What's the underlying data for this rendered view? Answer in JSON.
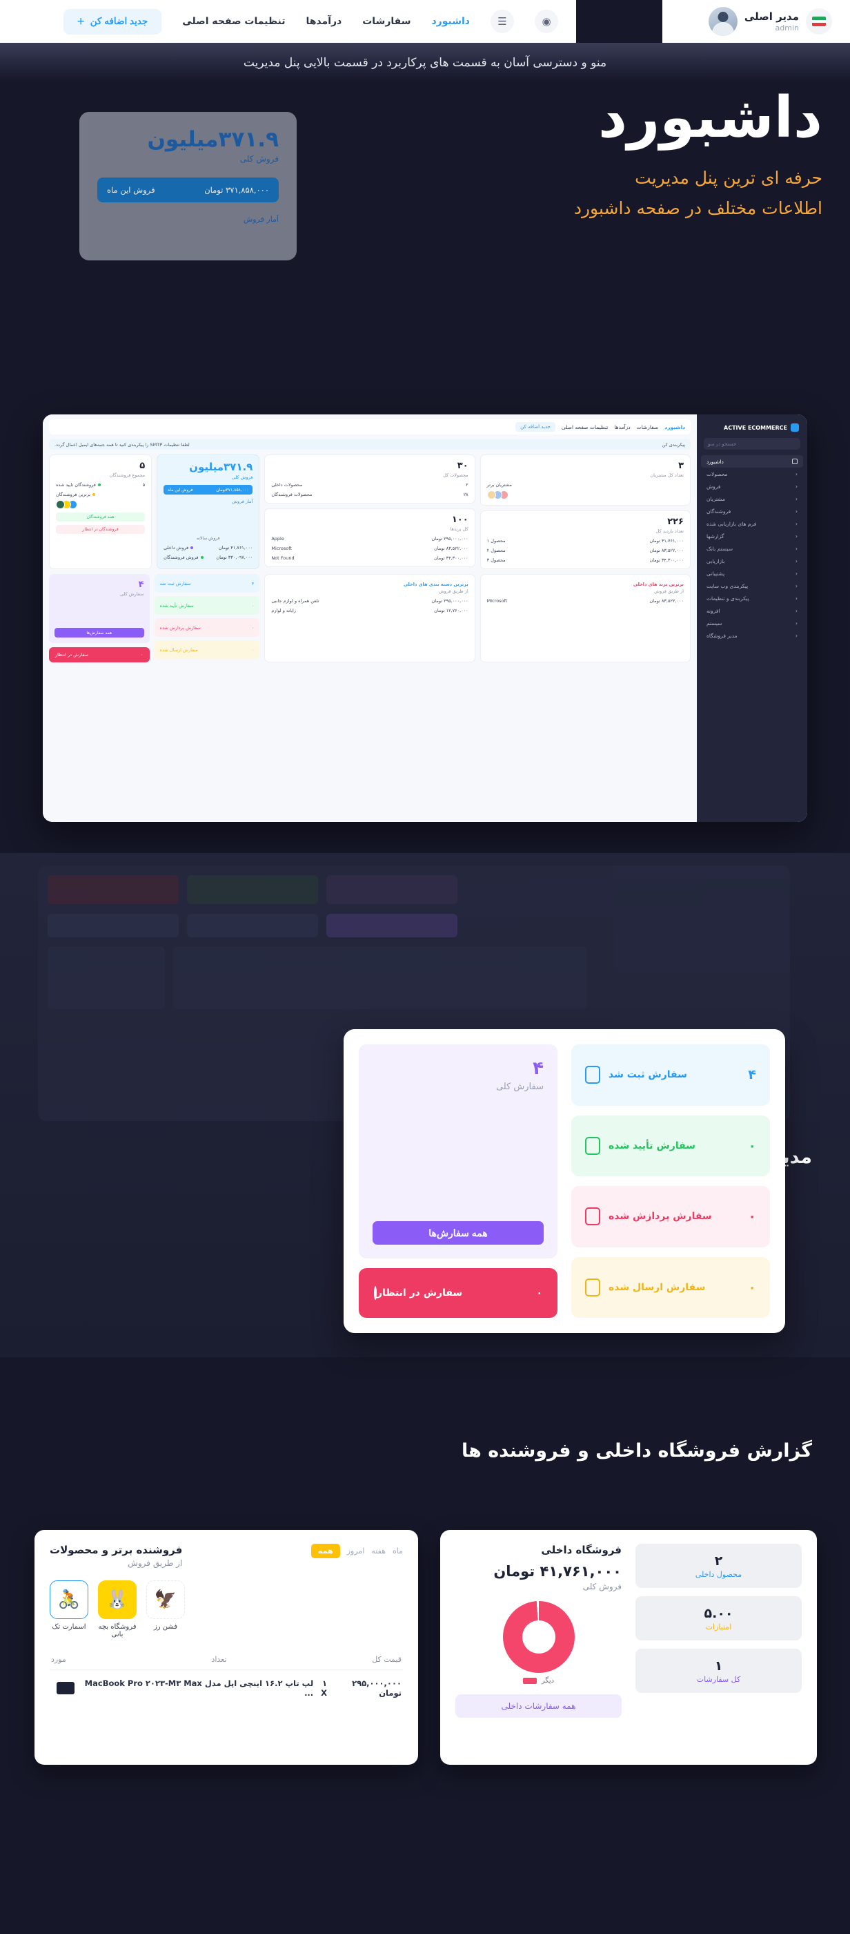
{
  "topbar": {
    "user_name": "مدیر اصلی",
    "user_role": "admin",
    "flag_name": "iran-flag",
    "add_button": "جدید اضافه کن",
    "nav": [
      {
        "label": "تنظیمات صفحه اصلی",
        "active": false
      },
      {
        "label": "درآمدها",
        "active": false
      },
      {
        "label": "سفارشات",
        "active": false
      },
      {
        "label": "داشبورد",
        "active": true
      }
    ],
    "icons": [
      "globe-icon",
      "chart-icon"
    ]
  },
  "banner": {
    "text": "منو و دسترسی آسان به قسمت های پرکاربرد در قسمت بالایی پنل مدیریت"
  },
  "hero": {
    "title": "داشبورد",
    "subtitle_1": "حرفه ای ترین پنل مدیریت",
    "subtitle_2": "اطلاعات مختلف در صفحه داشبورد",
    "card": {
      "amount": "۳۷۱.۹میلیون",
      "label": "فروش کلی",
      "bar_label": "فروش این ماه",
      "bar_value": "۳۷۱,۸۵۸,۰۰۰ تومان",
      "footer": "آمار فروش"
    },
    "accent_color": "#f7a738"
  },
  "shot": {
    "sidebar": {
      "logo": "ACTIVE ECOMMERCE",
      "search_placeholder": "جستجو در منو",
      "items": [
        {
          "label": "داشبورد",
          "active": true
        },
        {
          "label": "محصولات",
          "active": false
        },
        {
          "label": "فروش",
          "active": false
        },
        {
          "label": "مشتریان",
          "active": false
        },
        {
          "label": "فروشندگان",
          "active": false
        },
        {
          "label": "فرم های بازاریابی شده",
          "active": false
        },
        {
          "label": "گزارشها",
          "active": false
        },
        {
          "label": "سیستم بانک",
          "active": false
        },
        {
          "label": "بازاریابی",
          "active": false
        },
        {
          "label": "پشتیبانی",
          "active": false
        },
        {
          "label": "پیکربندی وب سایت",
          "active": false
        },
        {
          "label": "پیکربندی و تنظیمات",
          "active": false
        },
        {
          "label": "افزونه",
          "active": false
        },
        {
          "label": "سیستم",
          "active": false
        },
        {
          "label": "مدیر فروشگاه",
          "active": false
        }
      ]
    },
    "topnav": [
      {
        "label": "تنظیمات صفحه اصلی",
        "active": false
      },
      {
        "label": "درآمدها",
        "active": false
      },
      {
        "label": "سفارشات",
        "active": false
      },
      {
        "label": "داشبورد",
        "active": true
      }
    ],
    "add_button": "جدید اضافه کن",
    "notice": "لطفا تنظیمات SMTP را پیکربندی کنید تا همه جنبه‌های ایمیل اعمال گردد.",
    "notice_action": "پیکربندی کن",
    "cards": {
      "vendors": {
        "number": "۵",
        "label": "مجموع فروشندگان",
        "rows": [
          {
            "label": "فروشندگان تایید شده",
            "value": "۵",
            "color": "#22c55e"
          },
          {
            "label": "برترین فروشندگان",
            "value": "",
            "color": "#ffc107"
          }
        ],
        "btn_all": "همه فروشندگان",
        "btn_pending": "فروشندگان در انتظار"
      },
      "sales": {
        "amount": "۳۷۱.۹میلیون",
        "label": "فروش کلی",
        "bar_label": "فروش این ماه",
        "bar_value": "۳۷۱,۸۵۸,۰۰۰تومان",
        "sub": "آمار فروش",
        "chart_label": "فروش سالانه",
        "legend": [
          {
            "name": "فروش داخلی",
            "value": "۴۱,۷۶۱,۰۰۰ تومان",
            "color": "#8b5cf6"
          },
          {
            "name": "فروش فروشندگان",
            "value": "۳۳۰,۰۹۷,۰۰۰ تومان",
            "color": "#22c55e"
          }
        ]
      },
      "products": {
        "number": "۳۰",
        "label": "محصولات کل",
        "rows": [
          {
            "label": "محصولات داخلی",
            "value": "۲"
          },
          {
            "label": "محصولات فروشندگان",
            "value": "۲۸"
          }
        ]
      },
      "customers": {
        "number": "۳",
        "label": "تعداد کل مشتریان",
        "row_label": "مشتریان برتر"
      },
      "orders_count": {
        "number": "۱۰۰",
        "label": "کل برندها",
        "rows": [
          {
            "label": "Apple",
            "value": "۲۹۵,۰۰۰,۰۰۰ تومان"
          },
          {
            "label": "Microsoft",
            "value": "۸۳,۵۲۲,۰۰۰ تومان"
          },
          {
            "label": "Not Found",
            "value": "۳۴,۳۰۰,۰۰۰ تومان"
          }
        ],
        "sub": "برندهای برتر"
      },
      "total": {
        "number": "۲۲۶",
        "label": "تعداد بازدید کل",
        "rows": [
          {
            "label": "محصول ۱",
            "value": "۴۱,۷۶۱,۰۰۰ تومان"
          },
          {
            "label": "محصول ۲",
            "value": "۸۳,۵۲۲,۰۰۰ تومان"
          },
          {
            "label": "محصول ۳",
            "value": "۳۴,۳۰۰,۰۰۰ تومان"
          }
        ]
      }
    },
    "orders_panel": {
      "rows": [
        {
          "label": "سفارش ثبت شد",
          "value": "۴",
          "bg": "#eaf6fe",
          "fg": "#2a9bf2"
        },
        {
          "label": "سفارش تأیید شده",
          "value": "۰",
          "bg": "#e8fbef",
          "fg": "#22c55e"
        },
        {
          "label": "سفارش پردازش شده",
          "value": "۰",
          "bg": "#fdeef2",
          "fg": "#ee3b63"
        },
        {
          "label": "سفارش ارسال شده",
          "value": "۰",
          "bg": "#fef7e0",
          "fg": "#f0b41a"
        }
      ],
      "total_value": "۴",
      "total_label": "سفارش کلی",
      "all_btn": "همه سفارش‌ها",
      "pending_label": "سفارش در انتظار",
      "pending_value": "۰"
    },
    "bottom_left": {
      "title": "برترین برند های داخلی",
      "sub": "از طریق فروش",
      "rows": [
        {
          "name": "Microsoft",
          "value": "۸۳,۵۲۲,۰۰۰ تومان"
        }
      ]
    },
    "bottom_mid": {
      "title": "برترین دسته بندی های داخلی",
      "sub": "از طریق فروش",
      "rows": [
        {
          "name": "تلفن همراه و لوازم جانبی",
          "value": "۲۹۵,۰۰۰,۰۰۰ تومان"
        },
        {
          "name": "رایانه و لوازم",
          "value": "۱۲,۷۶۰,۰۰۰ تومان"
        }
      ]
    }
  },
  "section_orders": {
    "heading": "مدیریت تمام سفارش ها یکجا",
    "card": {
      "rows": [
        {
          "label": "سفارش ثبت شد",
          "value": "۴",
          "bg": "#edf7fe",
          "fg": "#2a9bf2",
          "icon": "order-registered-icon"
        },
        {
          "label": "سفارش تأیید شده",
          "value": "۰",
          "bg": "#e9fbf0",
          "fg": "#22c55e",
          "icon": "order-confirmed-icon"
        },
        {
          "label": "سفارش پردازش شده",
          "value": "۰",
          "bg": "#fdeff3",
          "fg": "#ee3b63",
          "icon": "order-processing-icon"
        },
        {
          "label": "سفارش ارسال شده",
          "value": "۰",
          "bg": "#fdf7e3",
          "fg": "#f0b41a",
          "icon": "order-shipped-icon"
        }
      ],
      "total_value": "۴",
      "total_label": "سفارش کلی",
      "all_button": "همه سفارش‌ها",
      "pending_label": "سفارش در انتظار",
      "pending_value": "۰"
    }
  },
  "section_reports": {
    "heading": "گزارش فروشگاه داخلی و فروشنده ها",
    "top_sellers": {
      "title": "فروشنده برتر و محصولات",
      "subtitle": "از طریق فروش",
      "tabs": [
        {
          "label": "همه",
          "active": true
        },
        {
          "label": "امروز",
          "active": false
        },
        {
          "label": "هفته",
          "active": false
        },
        {
          "label": "ماه",
          "active": false
        }
      ],
      "brands": [
        {
          "name": "اسمارت تک",
          "glyph": "🚴",
          "bg": "#ffffff",
          "border": "#2a9bf2"
        },
        {
          "name": "فروشگاه بچه بانی",
          "glyph": "🐰",
          "bg": "#ffd400",
          "border": "#ffd400"
        },
        {
          "name": "فشن رز",
          "glyph": "🦅",
          "bg": "#ffffff",
          "border": "#e7eaf0"
        }
      ],
      "columns": [
        "قیمت کل",
        "تعداد",
        "مورد"
      ],
      "rows": [
        {
          "item": "لپ تاپ ۱۶.۲ اینچی اپل مدل MacBook Pro ۲۰۲۳-M۳ Max ...",
          "qty": "۱ X",
          "total": "۲۹۵,۰۰۰,۰۰۰ تومان"
        }
      ]
    },
    "inhouse": {
      "title": "فروشگاه داخلی",
      "amount": "۴۱,۷۶۱,۰۰۰ تومان",
      "label": "فروش کلی",
      "stats": [
        {
          "value": "۲",
          "label": "محصول داخلی",
          "color": "#2a9bf2"
        },
        {
          "value": "۵.۰۰",
          "label": "امتیازات",
          "color": "#f0b41a"
        },
        {
          "value": "۱",
          "label": "کل سفارشات",
          "color": "#8b5cf6"
        }
      ],
      "legend_label": "دیگر",
      "legend_color": "#f4456b",
      "all_button": "همه سفارشات داخلی"
    },
    "chart_data": {
      "type": "pie",
      "title": "فروشگاه داخلی",
      "categories": [
        "دیگر"
      ],
      "values": [
        100
      ],
      "colors": [
        "#f4456b"
      ],
      "legend_position": "bottom"
    }
  }
}
